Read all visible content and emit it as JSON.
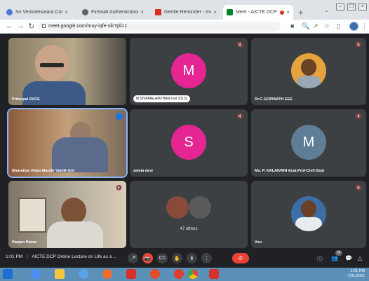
{
  "browser": {
    "tabs": [
      {
        "label": "Sri Venkateswara College",
        "color": "#4a7bd0"
      },
      {
        "label": "Firewall Authentication K",
        "color": "#5f6368"
      },
      {
        "label": "Gentle Reminder - Invita",
        "color": "#d93025"
      },
      {
        "label": "Meet - AICTE DCP O",
        "color": "#00832d",
        "active": true
      }
    ],
    "new_tab": "+",
    "tab_close": "×",
    "tabs_menu": "⌄",
    "url": "meet.google.com/muy-iqfe-sik?pli=1",
    "window_controls": [
      "–",
      "❐",
      "×"
    ],
    "toolbar_icons": [
      "■",
      "🔍",
      "↗",
      "☆",
      "▯"
    ]
  },
  "meet": {
    "tiles": [
      {
        "name": "Principal SVCE",
        "kind": "video"
      },
      {
        "name": "M.SIVAMALAIATHAN-civil 10131",
        "kind": "avatar",
        "letter": "M",
        "color": "#e52592"
      },
      {
        "name": "Dr.C.GOPINATH EEE",
        "kind": "photo"
      },
      {
        "name": "Bharatiya Vidya Mandir Vaidik Girl",
        "kind": "video"
      },
      {
        "name": "selvia devi",
        "kind": "avatar",
        "letter": "S",
        "color": "#e52592"
      },
      {
        "name": "Ms. P. KALAIVANI Asst.Prof-Civil Dept",
        "kind": "avatar",
        "letter": "M",
        "color": "#5f7d95"
      },
      {
        "name": "Ranjan Raina",
        "kind": "video"
      },
      {
        "name": "47 others",
        "kind": "group"
      },
      {
        "name": "You",
        "kind": "photo"
      }
    ],
    "mute_icon": "🔇"
  },
  "bottom": {
    "time": "1:01 PM",
    "separator": "|",
    "title": "AICTE DCP Online Lecture on Life as a ...",
    "hangup_icon": "✆",
    "participant_count": "54",
    "controls": [
      "🎤",
      "📷",
      "CC",
      "✋",
      "⬆",
      "⋮"
    ],
    "right_icons": [
      "ⓘ",
      "👥",
      "💬",
      "△"
    ]
  },
  "taskbar": {
    "time": "1:01 PM",
    "date": "7/31/2021"
  }
}
